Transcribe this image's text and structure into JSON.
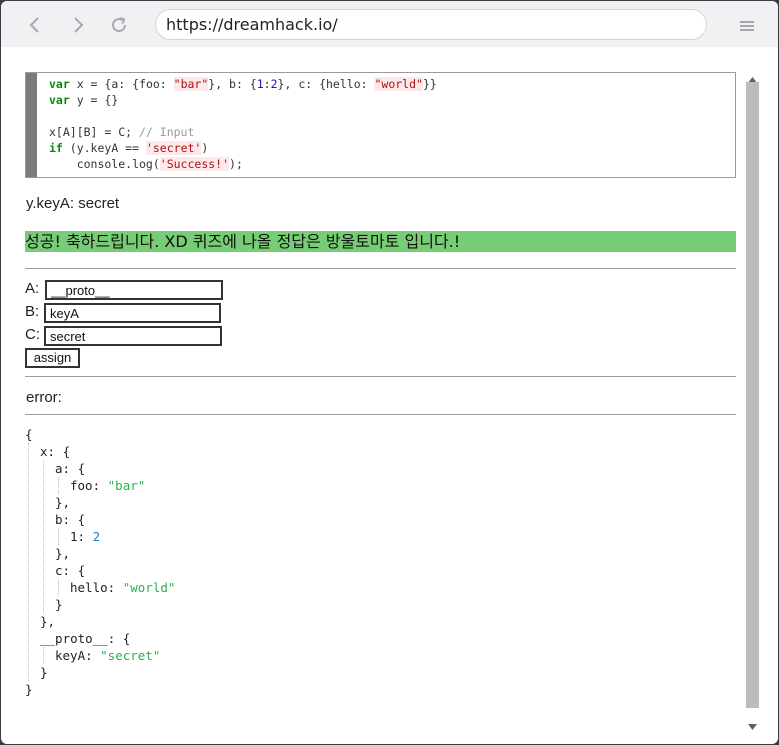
{
  "browser": {
    "url": "https://dreamhack.io/",
    "back_icon": "back-arrow-icon",
    "forward_icon": "forward-arrow-icon",
    "reload_icon": "reload-icon",
    "menu_icon": "hamburger-menu-icon"
  },
  "code": {
    "line1_kw": "var",
    "line1_a": " x = {a: {foo: ",
    "line1_s1": "\"bar\"",
    "line1_b": "}, b: {",
    "line1_n1": "1",
    "line1_c": ":",
    "line1_n2": "2",
    "line1_d": "}, c: {hello: ",
    "line1_s2": "\"world\"",
    "line1_e": "}}",
    "line2_kw": "var",
    "line2_a": " y = {}",
    "line4_a": "x[A][B] = C; ",
    "line4_cm": "// Input",
    "line5_kw": "if",
    "line5_a": " (y.keyA == ",
    "line5_s": "'secret'",
    "line5_b": ")",
    "line6_a": "    console.log(",
    "line6_s": "'Success!'",
    "line6_b": ");"
  },
  "result": {
    "ykey": "y.keyA: secret",
    "success_message": "성공! 축하드립니다. XD 퀴즈에 나올 정답은 방울토마토 입니다.!"
  },
  "form": {
    "a_label": "A:",
    "a_value": "__proto__",
    "b_label": "B:",
    "b_value": "keyA",
    "c_label": "C:",
    "c_value": "secret",
    "assign_label": "assign"
  },
  "error_label": "error:",
  "json_view": {
    "open": "{",
    "x_key": "x: {",
    "a_key": "a: {",
    "foo_key": "foo: ",
    "foo_val": "\"bar\"",
    "a_close": "},",
    "b_key": "b: {",
    "one_key": "1: ",
    "one_val": "2",
    "b_close": "},",
    "c_key": "c: {",
    "hello_key": "hello: ",
    "hello_val": "\"world\"",
    "c_close": "}",
    "x_close": "},",
    "proto_key": "__proto__: {",
    "keyA_key": "keyA: ",
    "keyA_val": "\"secret\"",
    "proto_close": "}",
    "close": "}"
  },
  "colors": {
    "success_bg": "#77cd75",
    "json_string": "#2bb14a",
    "json_number": "#2a7fd4",
    "code_bar": "#7a7a7a"
  }
}
